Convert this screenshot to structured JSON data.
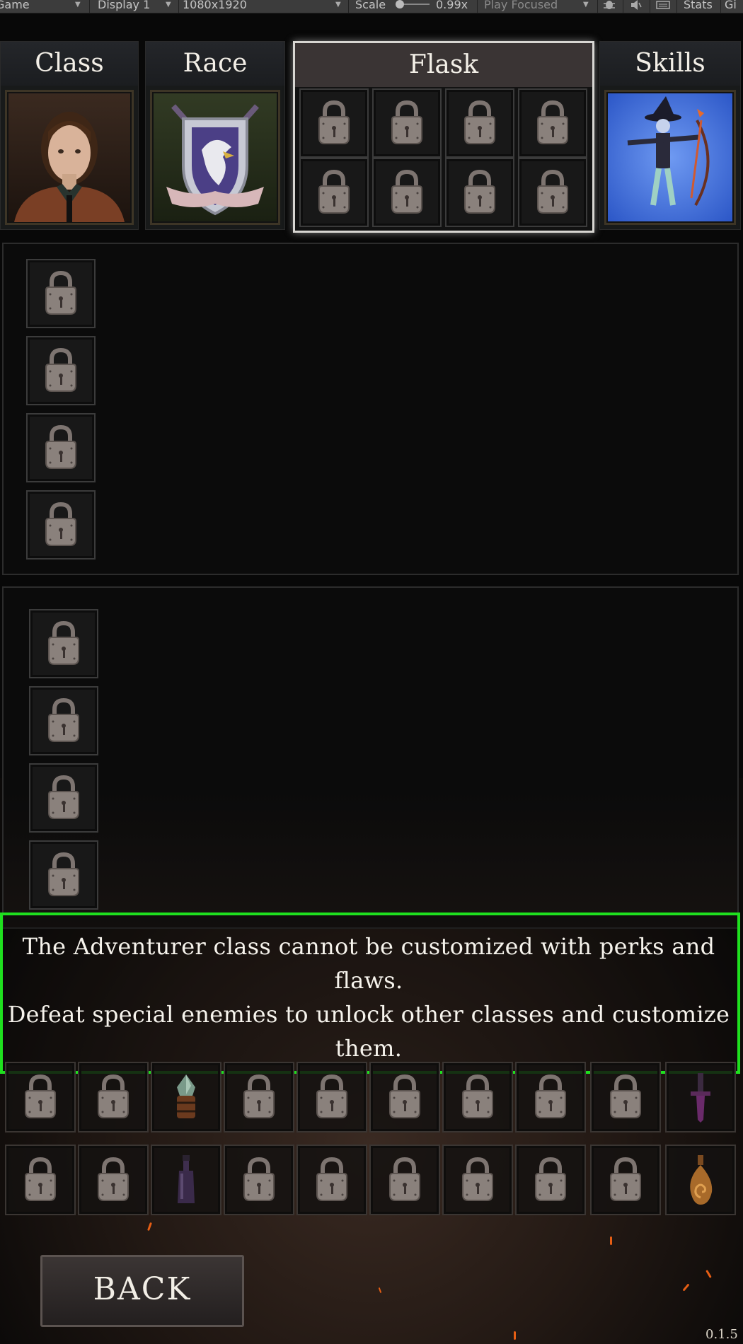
{
  "toolbar": {
    "game_view": "Game",
    "display": "Display 1",
    "resolution": "1080x1920",
    "scale_label": "Scale",
    "scale_value": "0.99x",
    "play_mode": "Play Focused",
    "stats": "Stats",
    "gizmos": "Gi"
  },
  "tabs": {
    "class": "Class",
    "race": "Race",
    "flask": "Flask",
    "skills": "Skills"
  },
  "message": {
    "line1": "The Adventurer class cannot be customized with perks and",
    "line2": "flaws.",
    "line3": "Defeat special enemies to unlock other classes and customize",
    "line4": "them."
  },
  "back_label": "BACK",
  "version": "0.1.5",
  "colors": {
    "highlight_border": "#1fe01f",
    "background": "#080808",
    "ember": "#e65e14"
  }
}
